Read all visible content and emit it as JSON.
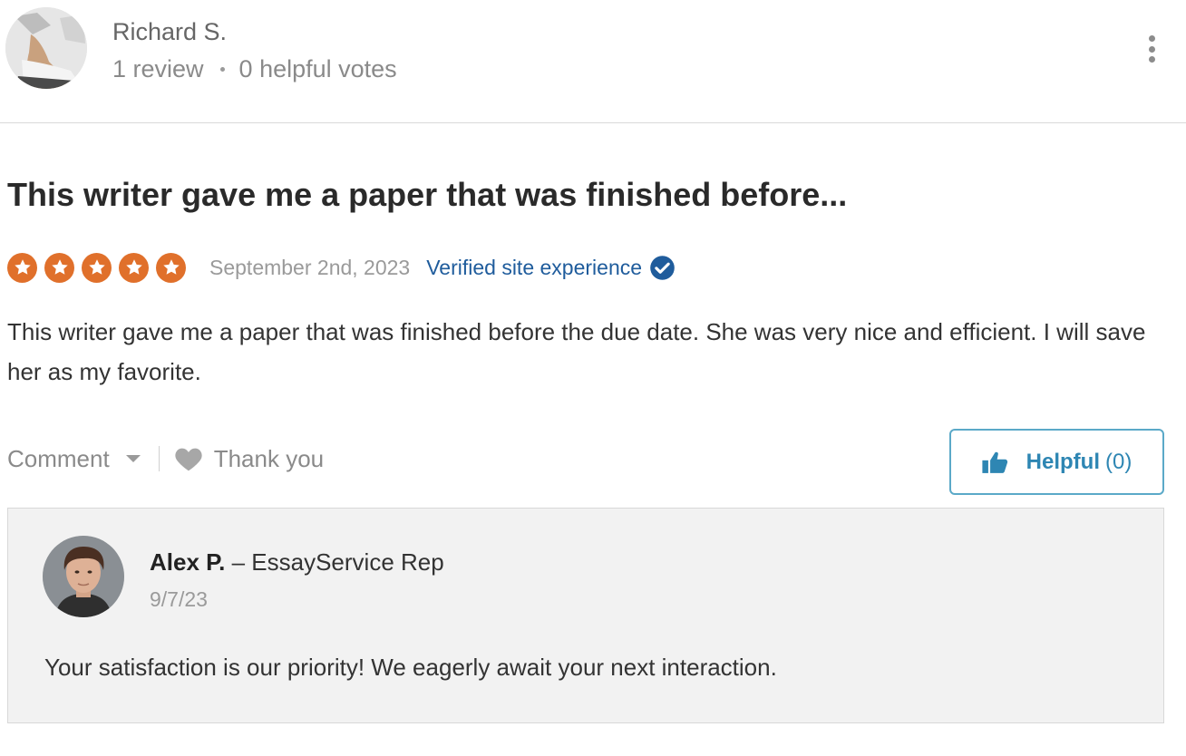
{
  "reviewer": {
    "name": "Richard S.",
    "reviews": "1 review",
    "helpful_votes": "0 helpful votes"
  },
  "review": {
    "title": "This writer gave me a paper that was finished before...",
    "rating": 5,
    "date": "September 2nd, 2023",
    "verified_label": "Verified site experience",
    "body": "This writer gave me a paper that was finished before the due date. She was very nice and efficient. I will save her as my favorite."
  },
  "actions": {
    "comment_label": "Comment",
    "thank_label": "Thank you",
    "helpful_label": "Helpful",
    "helpful_count": "(0)"
  },
  "reply": {
    "author": "Alex P.",
    "role": "– EssayService Rep",
    "date": "9/7/23",
    "text": "Your satisfaction is our priority! We eagerly await your next interaction."
  },
  "colors": {
    "star": "#e0702b",
    "link": "#1f5c9c",
    "helpful": "#2e86b3",
    "reply_bg": "#f2f2f2"
  }
}
